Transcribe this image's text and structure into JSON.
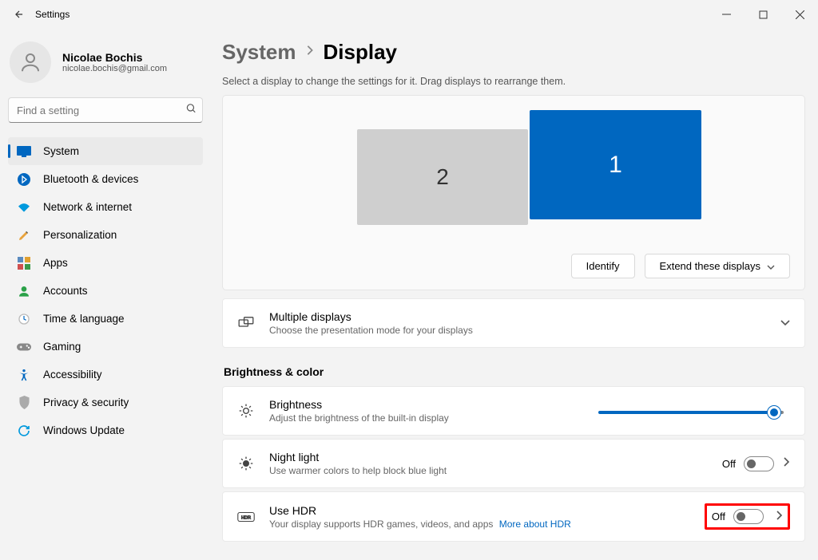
{
  "window": {
    "title": "Settings"
  },
  "user": {
    "name": "Nicolae Bochis",
    "email": "nicolae.bochis@gmail.com"
  },
  "search": {
    "placeholder": "Find a setting"
  },
  "nav": {
    "items": [
      {
        "label": "System"
      },
      {
        "label": "Bluetooth & devices"
      },
      {
        "label": "Network & internet"
      },
      {
        "label": "Personalization"
      },
      {
        "label": "Apps"
      },
      {
        "label": "Accounts"
      },
      {
        "label": "Time & language"
      },
      {
        "label": "Gaming"
      },
      {
        "label": "Accessibility"
      },
      {
        "label": "Privacy & security"
      },
      {
        "label": "Windows Update"
      }
    ]
  },
  "breadcrumb": {
    "parent": "System",
    "current": "Display"
  },
  "subtitle": "Select a display to change the settings for it. Drag displays to rearrange them.",
  "monitors": {
    "m1": "1",
    "m2": "2"
  },
  "actions": {
    "identify": "Identify",
    "extend": "Extend these displays"
  },
  "multiple_displays": {
    "title": "Multiple displays",
    "sub": "Choose the presentation mode for your displays"
  },
  "section_bc": "Brightness & color",
  "brightness": {
    "title": "Brightness",
    "sub": "Adjust the brightness of the built-in display",
    "value": 98
  },
  "night_light": {
    "title": "Night light",
    "sub": "Use warmer colors to help block blue light",
    "state": "Off"
  },
  "hdr": {
    "title": "Use HDR",
    "sub": "Your display supports HDR games, videos, and apps",
    "link": "More about HDR",
    "state": "Off"
  }
}
